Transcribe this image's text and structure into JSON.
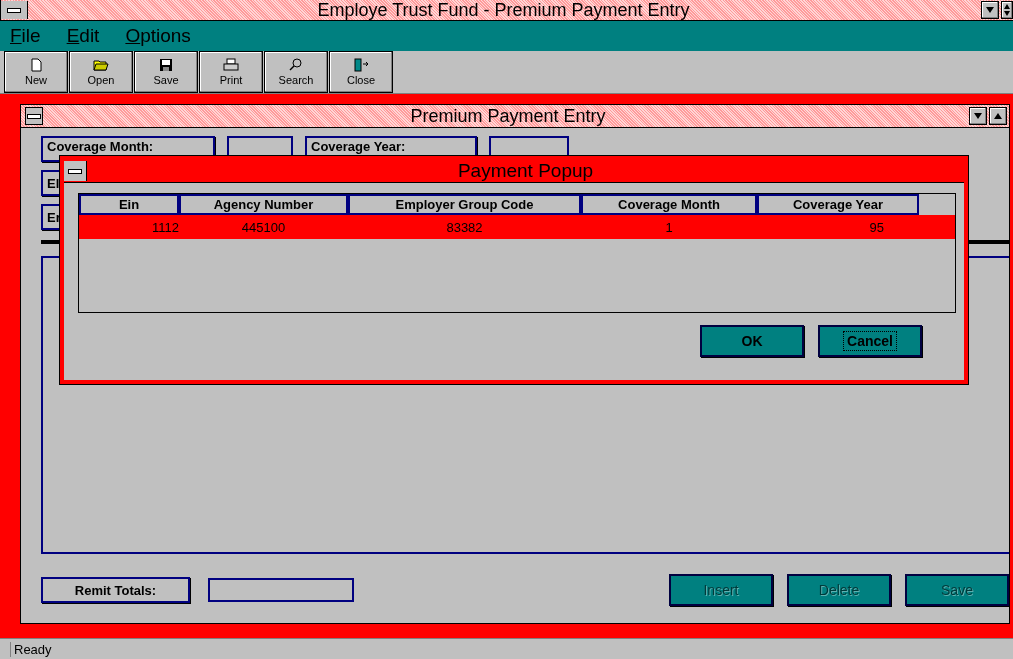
{
  "window": {
    "title": "Employe Trust Fund - Premium Payment Entry"
  },
  "menu": [
    {
      "label": "File"
    },
    {
      "label": "Edit"
    },
    {
      "label": "Options"
    }
  ],
  "toolbar": [
    {
      "label": "New",
      "kind": "new"
    },
    {
      "label": "Open",
      "kind": "open"
    },
    {
      "label": "Save",
      "kind": "save"
    },
    {
      "label": "Print",
      "kind": "print"
    },
    {
      "label": "Search",
      "kind": "search"
    },
    {
      "label": "Close",
      "kind": "close"
    }
  ],
  "child_window": {
    "title": "Premium Payment Entry",
    "top_labels": [
      "Coverage Month:",
      "Coverage Year:"
    ],
    "side_labels": [
      "El",
      "Er"
    ],
    "remit_totals_label": "Remit Totals:",
    "buttons": [
      {
        "label": "Insert",
        "disabled": true
      },
      {
        "label": "Delete",
        "disabled": true
      },
      {
        "label": "Save",
        "disabled": true
      }
    ]
  },
  "popup": {
    "title": "Payment Popup",
    "columns": [
      "Ein",
      "Agency Number",
      "Employer Group Code",
      "Coverage Month",
      "Coverage Year"
    ],
    "rows": [
      {
        "cells": [
          "1112",
          "445100",
          "83382",
          "1",
          "95"
        ],
        "selected": true
      }
    ],
    "buttons": [
      {
        "label": "OK",
        "focused": false
      },
      {
        "label": "Cancel",
        "focused": true
      }
    ]
  },
  "status_bar": {
    "text": "Ready"
  }
}
